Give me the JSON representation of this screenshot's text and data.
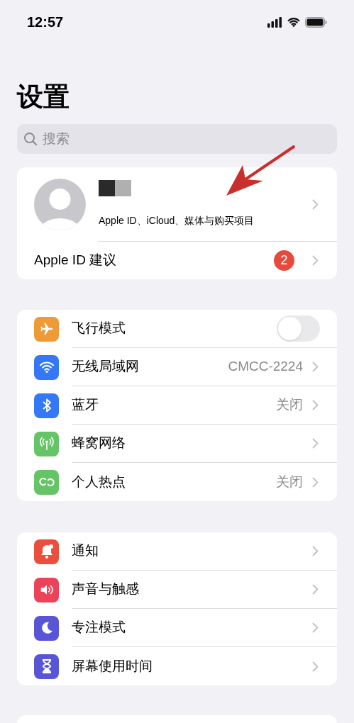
{
  "status_bar": {
    "time": "12:57"
  },
  "title": "设置",
  "search": {
    "placeholder": "搜索"
  },
  "account": {
    "subtitle": "Apple ID、iCloud、媒体与购买项目",
    "suggestion": {
      "label": "Apple ID 建议",
      "badge": "2"
    }
  },
  "groups": [
    {
      "rows": [
        {
          "label": "飞行模式",
          "color": "#f09a37",
          "kind": "toggle",
          "on": false
        },
        {
          "label": "无线局域网",
          "color": "#3478f6",
          "kind": "value",
          "value": "CMCC-2224"
        },
        {
          "label": "蓝牙",
          "color": "#3478f6",
          "kind": "value",
          "value": "关闭"
        },
        {
          "label": "蜂窝网络",
          "color": "#65c466",
          "kind": "plain"
        },
        {
          "label": "个人热点",
          "color": "#65c466",
          "kind": "value",
          "value": "关闭"
        }
      ]
    },
    {
      "rows": [
        {
          "label": "通知",
          "color": "#eb4e3d",
          "kind": "plain"
        },
        {
          "label": "声音与触感",
          "color": "#eb445a",
          "kind": "plain"
        },
        {
          "label": "专注模式",
          "color": "#5856d6",
          "kind": "plain"
        },
        {
          "label": "屏幕使用时间",
          "color": "#5856d6",
          "kind": "plain"
        }
      ]
    }
  ]
}
